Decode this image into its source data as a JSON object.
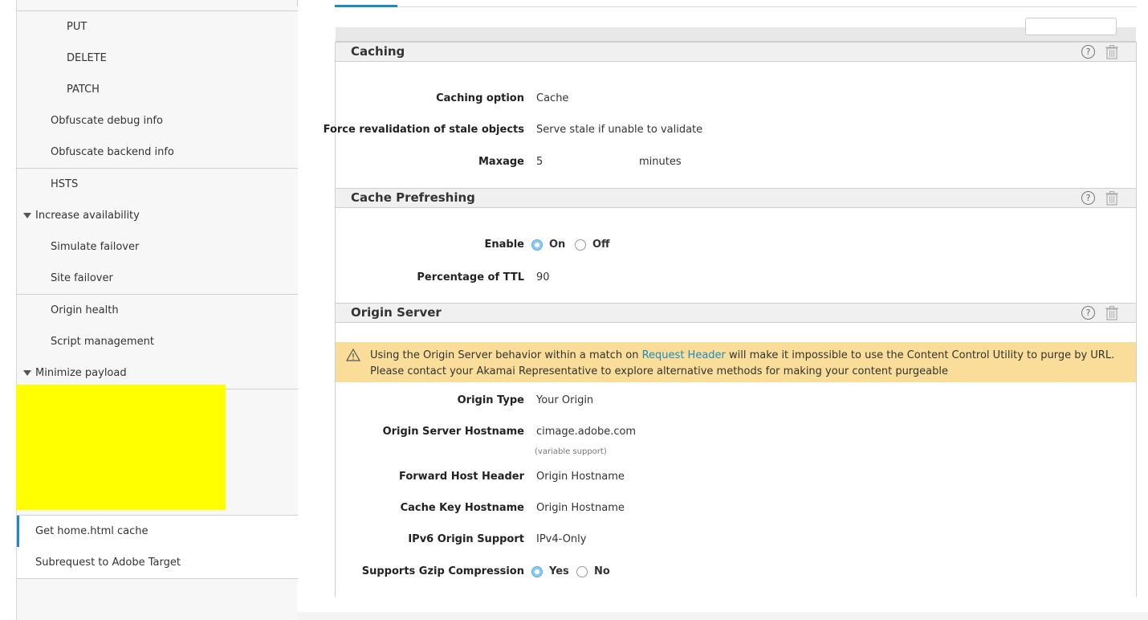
{
  "sidebar": {
    "items": [
      {
        "label": "PUT"
      },
      {
        "label": "DELETE"
      },
      {
        "label": "PATCH"
      },
      {
        "label": "Obfuscate debug info"
      },
      {
        "label": "Obfuscate backend info"
      },
      {
        "label": "HSTS"
      },
      {
        "label": "Increase availability"
      },
      {
        "label": "Simulate failover"
      },
      {
        "label": "Site failover"
      },
      {
        "label": "Origin health"
      },
      {
        "label": "Script management"
      },
      {
        "label": "Minimize payload"
      },
      {
        "label": "Get home.html cache"
      },
      {
        "label": "Subrequest to Adobe Target"
      }
    ]
  },
  "caching": {
    "title": "Caching",
    "option_label": "Caching option",
    "option_value": "Cache",
    "force_label": "Force revalidation of stale objects",
    "force_value": "Serve stale if unable to validate",
    "maxage_label": "Maxage",
    "maxage_value": "5",
    "maxage_unit": "minutes"
  },
  "prefresh": {
    "title": "Cache Prefreshing",
    "enable_label": "Enable",
    "on_label": "On",
    "off_label": "Off",
    "enable_selected": "On",
    "ttl_label": "Percentage of TTL",
    "ttl_value": "90"
  },
  "origin": {
    "title": "Origin Server",
    "warning_pre": "Using the Origin Server behavior within a match on ",
    "warning_link": "Request Header",
    "warning_post": " will make it impossible to use the Content Control Utility to purge by URL. Please contact your Akamai Representative to explore alternative methods for making your content purgeable",
    "type_label": "Origin Type",
    "type_value": "Your Origin",
    "hostname_label": "Origin Server Hostname",
    "hostname_value": "cimage.adobe.com",
    "hostname_note": "(variable support)",
    "fwd_label": "Forward Host Header",
    "fwd_value": "Origin Hostname",
    "cachekey_label": "Cache Key Hostname",
    "cachekey_value": "Origin Hostname",
    "ipv6_label": "IPv6 Origin Support",
    "ipv6_value": "IPv4-Only",
    "gzip_label": "Supports Gzip Compression",
    "yes_label": "Yes",
    "no_label": "No",
    "gzip_selected": "Yes"
  },
  "help_glyph": "?",
  "icons": [
    "help-icon",
    "trash-icon",
    "warning-icon",
    "caret-down-icon"
  ],
  "colors": {
    "accent": "#1f8ac0",
    "warning_bg": "#f9dd98",
    "redaction": "#ffff00"
  }
}
